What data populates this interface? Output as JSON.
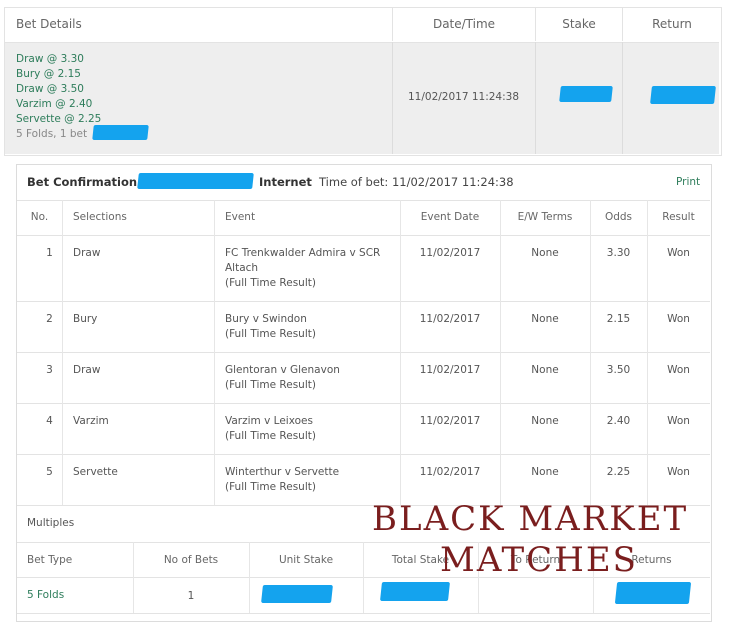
{
  "header": {
    "bet_details": "Bet Details",
    "date_time": "Date/Time",
    "stake": "Stake",
    "return": "Return"
  },
  "summary": {
    "selections": [
      "Draw @ 3.30",
      "Bury @ 2.15",
      "Draw @ 3.50",
      "Varzim @ 2.40",
      "Servette @ 2.25"
    ],
    "folds_line": "5 Folds, 1 bet",
    "datetime": "11/02/2017 11:24:38"
  },
  "confirmation": {
    "title": "Bet Confirmation",
    "channel": "Internet",
    "time_of_bet": "Time of bet: 11/02/2017 11:24:38",
    "print": "Print"
  },
  "table": {
    "columns": [
      "No.",
      "Selections",
      "Event",
      "Event Date",
      "E/W Terms",
      "Odds",
      "Result"
    ],
    "rows": [
      {
        "no": "1",
        "selection": "Draw",
        "event": "FC Trenkwalder Admira v SCR Altach",
        "market": "(Full Time Result)",
        "date": "11/02/2017",
        "ew": "None",
        "odds": "3.30",
        "result": "Won"
      },
      {
        "no": "2",
        "selection": "Bury",
        "event": "Bury v Swindon",
        "market": "(Full Time Result)",
        "date": "11/02/2017",
        "ew": "None",
        "odds": "2.15",
        "result": "Won"
      },
      {
        "no": "3",
        "selection": "Draw",
        "event": "Glentoran v Glenavon",
        "market": "(Full Time Result)",
        "date": "11/02/2017",
        "ew": "None",
        "odds": "3.50",
        "result": "Won"
      },
      {
        "no": "4",
        "selection": "Varzim",
        "event": "Varzim v Leixoes",
        "market": "(Full Time Result)",
        "date": "11/02/2017",
        "ew": "None",
        "odds": "2.40",
        "result": "Won"
      },
      {
        "no": "5",
        "selection": "Servette",
        "event": "Winterthur v Servette",
        "market": "(Full Time Result)",
        "date": "11/02/2017",
        "ew": "None",
        "odds": "2.25",
        "result": "Won"
      }
    ]
  },
  "multiples": {
    "title": "Multiples",
    "columns": [
      "Bet Type",
      "No of Bets",
      "Unit Stake",
      "Total Stake",
      "To Return",
      "Returns"
    ],
    "bet_type": "5 Folds",
    "no_of_bets": "1"
  },
  "watermark": {
    "line1": "BLACK MARKET",
    "line2": "MATCHES"
  },
  "colors": {
    "link_green": "#2e7d5b",
    "redaction_blue": "#14a3ee",
    "watermark": "#7a1e1e",
    "summary_bg": "#eeeeee"
  }
}
